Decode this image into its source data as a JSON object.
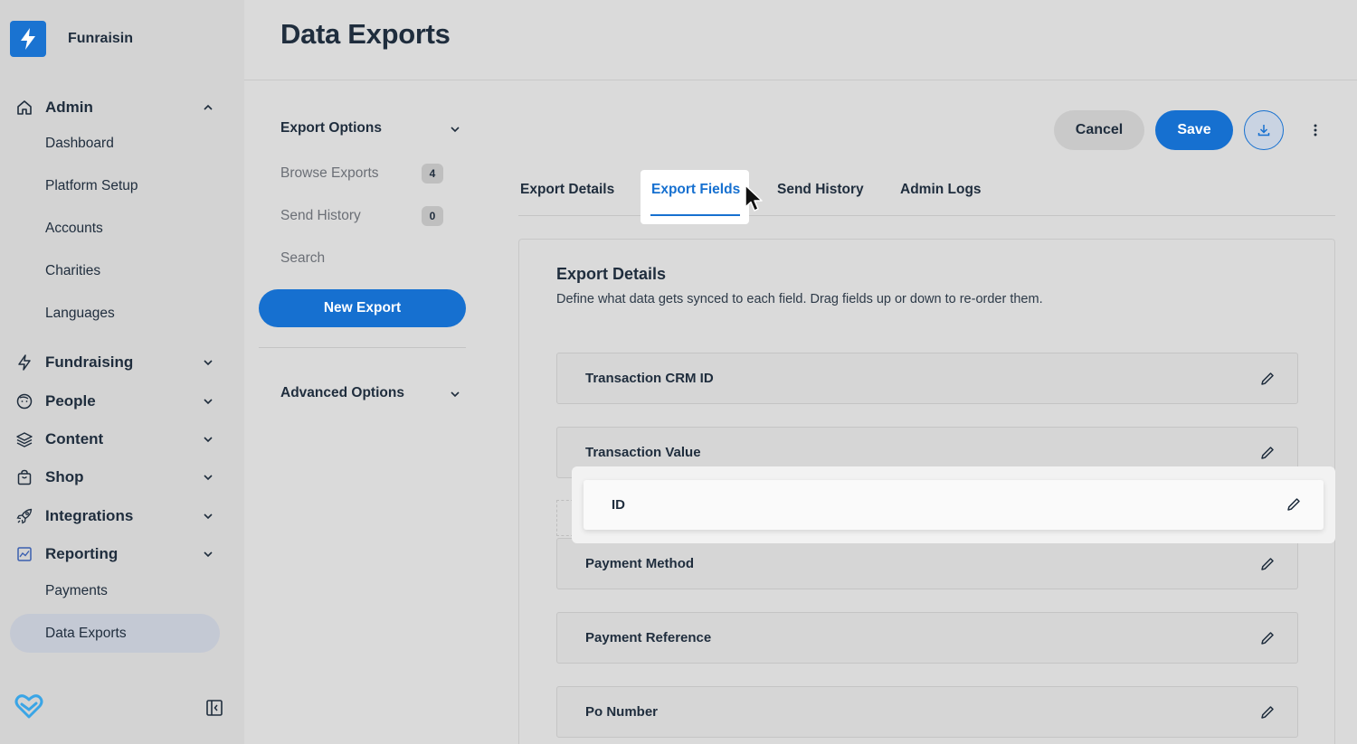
{
  "app": {
    "name": "Funraisin"
  },
  "sidebar": {
    "groups": [
      {
        "label": "Admin",
        "icon": "home-icon",
        "expanded": true
      },
      {
        "label": "Fundraising",
        "icon": "bolt-icon",
        "expanded": false
      },
      {
        "label": "People",
        "icon": "face-icon",
        "expanded": false
      },
      {
        "label": "Content",
        "icon": "layers-icon",
        "expanded": false
      },
      {
        "label": "Shop",
        "icon": "shopping-bag-icon",
        "expanded": false
      },
      {
        "label": "Integrations",
        "icon": "rocket-icon",
        "expanded": false
      },
      {
        "label": "Reporting",
        "icon": "chart-icon",
        "expanded": true
      }
    ],
    "admin_items": [
      "Dashboard",
      "Platform Setup",
      "Accounts",
      "Charities",
      "Languages"
    ],
    "reporting_items": [
      "Payments",
      "Data Exports"
    ],
    "active_item": "Data Exports"
  },
  "header": {
    "title": "Data Exports"
  },
  "options": {
    "export_options_label": "Export Options",
    "items": [
      {
        "label": "Browse Exports",
        "badge": "4"
      },
      {
        "label": "Send History",
        "badge": "0"
      },
      {
        "label": "Search"
      }
    ],
    "new_export_label": "New Export",
    "advanced_options_label": "Advanced Options"
  },
  "actions": {
    "cancel_label": "Cancel",
    "save_label": "Save"
  },
  "tabs": [
    {
      "label": "Export Details",
      "active": false
    },
    {
      "label": "Export Fields",
      "active": true
    },
    {
      "label": "Send History",
      "active": false
    },
    {
      "label": "Admin Logs",
      "active": false
    }
  ],
  "card": {
    "title": "Export Details",
    "description": "Define what data gets synced to each field. Drag fields up or down to re-order them."
  },
  "fields": [
    "Transaction CRM ID",
    "Transaction Value",
    "Payment Method",
    "Payment Reference",
    "Po Number"
  ],
  "dragging_field": "ID",
  "colors": {
    "accent": "#1670d0",
    "sidebar_bg": "#d3d3d3",
    "page_bg": "#dadada"
  }
}
